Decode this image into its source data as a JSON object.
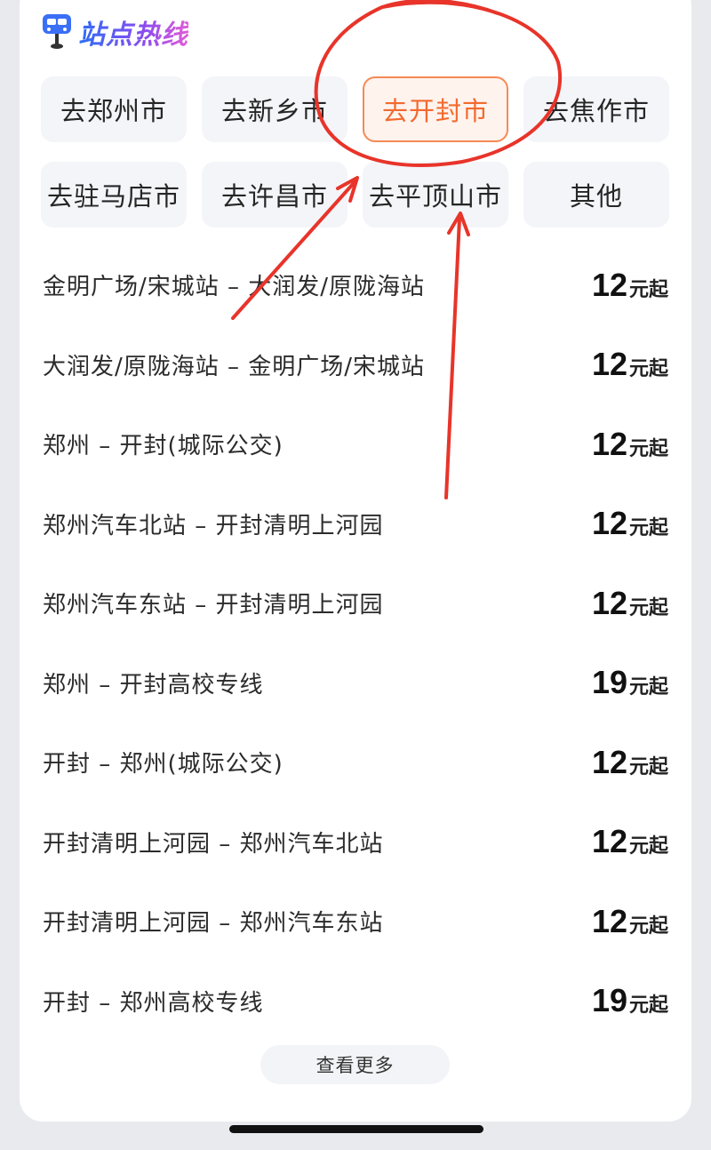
{
  "header": {
    "title": "站点热线",
    "icon": "bus-stop-sign-icon"
  },
  "city_tags": [
    {
      "label": "去郑州市",
      "active": false
    },
    {
      "label": "去新乡市",
      "active": false
    },
    {
      "label": "去开封市",
      "active": true
    },
    {
      "label": "去焦作市",
      "active": false
    },
    {
      "label": "去驻马店市",
      "active": false
    },
    {
      "label": "去许昌市",
      "active": false
    },
    {
      "label": "去平顶山市",
      "active": false
    },
    {
      "label": "其他",
      "active": false
    }
  ],
  "routes": [
    {
      "name": "金明广场/宋城站 – 大润发/原陇海站",
      "price": "12",
      "suffix": "元起"
    },
    {
      "name": "大润发/原陇海站 – 金明广场/宋城站",
      "price": "12",
      "suffix": "元起"
    },
    {
      "name": "郑州 – 开封(城际公交)",
      "price": "12",
      "suffix": "元起"
    },
    {
      "name": "郑州汽车北站 – 开封清明上河园",
      "price": "12",
      "suffix": "元起"
    },
    {
      "name": "郑州汽车东站 – 开封清明上河园",
      "price": "12",
      "suffix": "元起"
    },
    {
      "name": "郑州 – 开封高校专线",
      "price": "19",
      "suffix": "元起"
    },
    {
      "name": "开封 – 郑州(城际公交)",
      "price": "12",
      "suffix": "元起"
    },
    {
      "name": "开封清明上河园 – 郑州汽车北站",
      "price": "12",
      "suffix": "元起"
    },
    {
      "name": "开封清明上河园 – 郑州汽车东站",
      "price": "12",
      "suffix": "元起"
    },
    {
      "name": "开封 – 郑州高校专线",
      "price": "19",
      "suffix": "元起"
    }
  ],
  "more_label": "查看更多",
  "colors": {
    "accent": "#f26a2e",
    "annotation": "#e8342a"
  }
}
